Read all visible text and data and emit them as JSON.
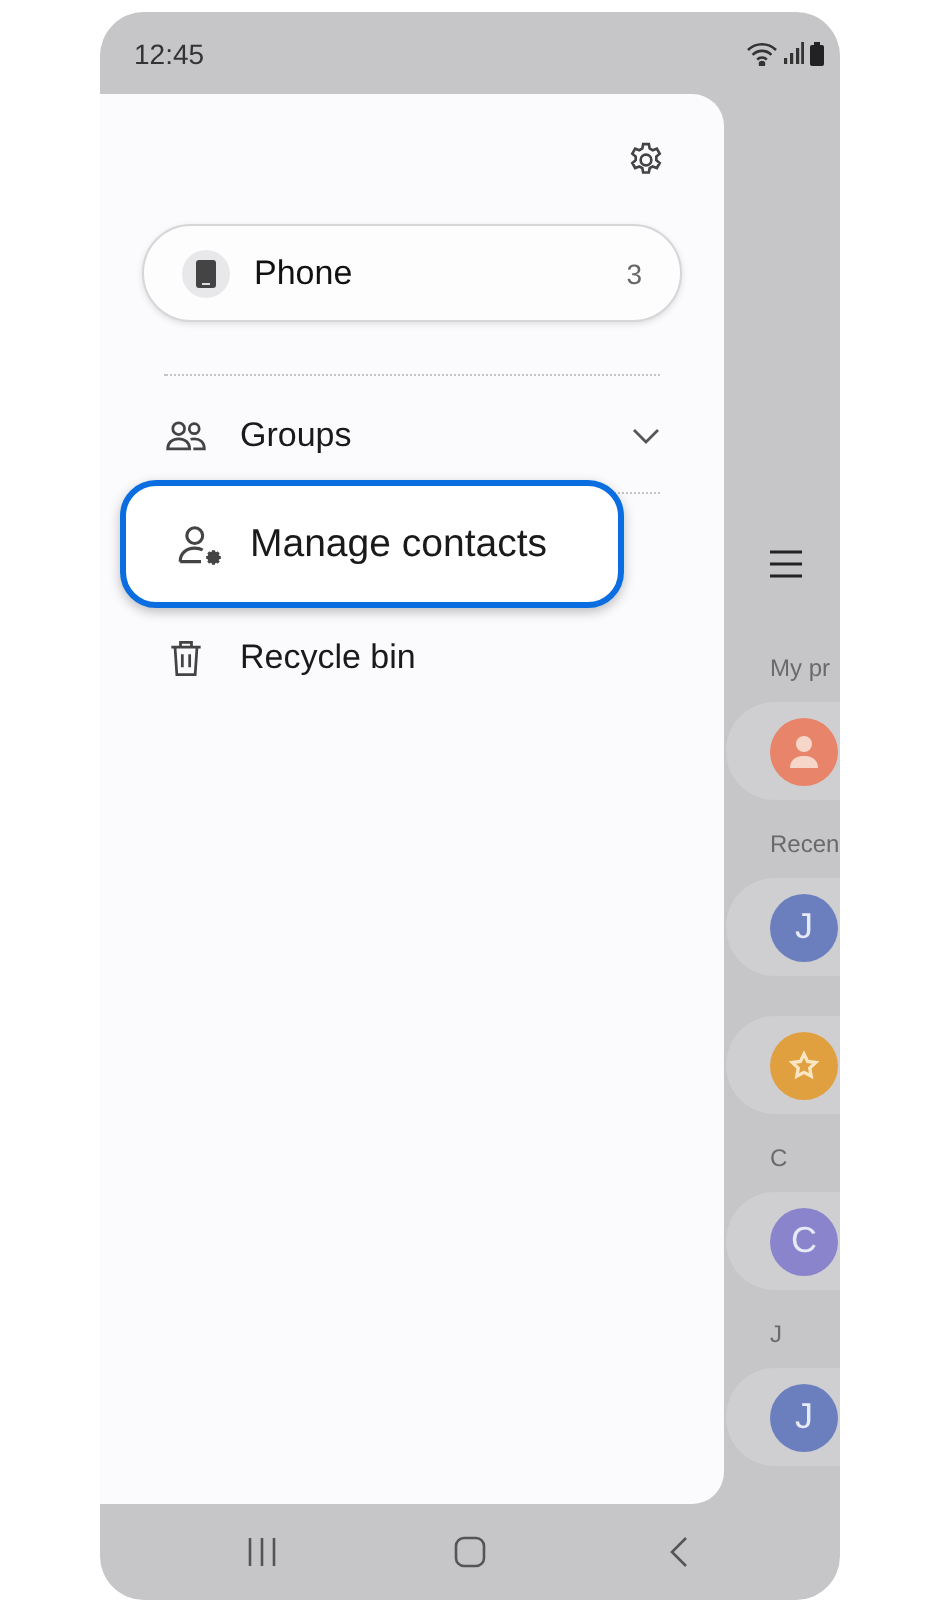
{
  "status_bar": {
    "time": "12:45"
  },
  "drawer": {
    "account": {
      "label": "Phone",
      "count": "3"
    },
    "items": [
      {
        "kind": "groups",
        "label": "Groups",
        "expandable": true,
        "highlighted": false
      },
      {
        "kind": "manage",
        "label": "Manage contacts",
        "expandable": false,
        "highlighted": true
      },
      {
        "kind": "recycle",
        "label": "Recycle bin",
        "expandable": false,
        "highlighted": false
      }
    ]
  },
  "background_list": [
    {
      "kind": "menu"
    },
    {
      "kind": "header",
      "text": "My pr"
    },
    {
      "kind": "profile",
      "color": "#e8846a"
    },
    {
      "kind": "header",
      "text": "Recen"
    },
    {
      "kind": "letter",
      "letter": "J",
      "color": "#6b7fbf"
    },
    {
      "kind": "star",
      "color": "#e0a040"
    },
    {
      "kind": "header",
      "text": "C"
    },
    {
      "kind": "letter",
      "letter": "C",
      "color": "#8a84cc"
    },
    {
      "kind": "header",
      "text": "J"
    },
    {
      "kind": "letter",
      "letter": "J",
      "color": "#6b7fbf"
    }
  ]
}
